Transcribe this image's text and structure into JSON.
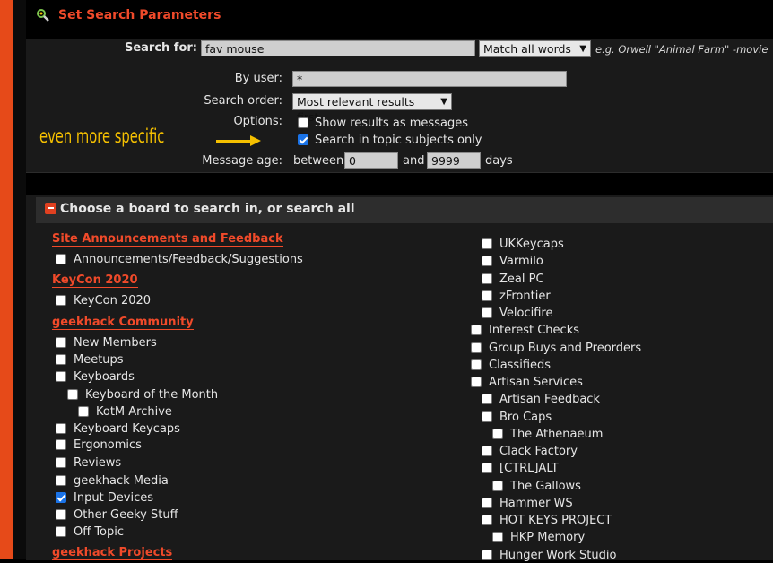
{
  "page": {
    "title": "Set Search Parameters"
  },
  "search": {
    "search_for_label": "Search for:",
    "query": "fav mouse",
    "match_mode": "Match all words",
    "example": "e.g. Orwell \"Animal Farm\" -movie",
    "by_user_label": "By user:",
    "by_user_value": "*",
    "order_label": "Search order:",
    "order_value": "Most relevant results first",
    "options_label": "Options:",
    "option_messages": "Show results as messages",
    "option_subjects": "Search in topic subjects only",
    "age_label": "Message age:",
    "age_between": "between",
    "age_min": "0",
    "age_and": "and",
    "age_max": "9999",
    "age_days": "days"
  },
  "annotation": {
    "text": "even more specific"
  },
  "boards_section": {
    "title": "Choose a board to search in, or search all"
  },
  "left_column": [
    {
      "type": "cat",
      "label": "Site Announcements and Feedback"
    },
    {
      "type": "board",
      "label": "Announcements/Feedback/Suggestions",
      "checked": false,
      "level": 0
    },
    {
      "type": "cat",
      "label": "KeyCon 2020"
    },
    {
      "type": "board",
      "label": "KeyCon 2020",
      "checked": false,
      "level": 0
    },
    {
      "type": "cat",
      "label": "geekhack Community"
    },
    {
      "type": "board",
      "label": "New Members",
      "checked": false,
      "level": 0
    },
    {
      "type": "board",
      "label": "Meetups",
      "checked": false,
      "level": 0
    },
    {
      "type": "board",
      "label": "Keyboards",
      "checked": false,
      "level": 0
    },
    {
      "type": "board",
      "label": "Keyboard of the Month",
      "checked": false,
      "level": 1
    },
    {
      "type": "board",
      "label": "KotM Archive",
      "checked": false,
      "level": 2
    },
    {
      "type": "board",
      "label": "Keyboard Keycaps",
      "checked": false,
      "level": 0
    },
    {
      "type": "board",
      "label": "Ergonomics",
      "checked": false,
      "level": 0
    },
    {
      "type": "board",
      "label": "Reviews",
      "checked": false,
      "level": 0
    },
    {
      "type": "board",
      "label": "geekhack Media",
      "checked": false,
      "level": 0
    },
    {
      "type": "board",
      "label": "Input Devices",
      "checked": true,
      "level": 0
    },
    {
      "type": "board",
      "label": "Other Geeky Stuff",
      "checked": false,
      "level": 0
    },
    {
      "type": "board",
      "label": "Off Topic",
      "checked": false,
      "level": 0
    },
    {
      "type": "cat",
      "label": "geekhack Projects"
    }
  ],
  "right_column": [
    {
      "label": "UKKeycaps",
      "checked": false,
      "level": 1
    },
    {
      "label": "Varmilo",
      "checked": false,
      "level": 1
    },
    {
      "label": "Zeal PC",
      "checked": false,
      "level": 1
    },
    {
      "label": "zFrontier",
      "checked": false,
      "level": 1
    },
    {
      "label": "Velocifire",
      "checked": false,
      "level": 1
    },
    {
      "label": "Interest Checks",
      "checked": false,
      "level": 0
    },
    {
      "label": "Group Buys and Preorders",
      "checked": false,
      "level": 0
    },
    {
      "label": "Classifieds",
      "checked": false,
      "level": 0
    },
    {
      "label": "Artisan Services",
      "checked": false,
      "level": 0
    },
    {
      "label": "Artisan Feedback",
      "checked": false,
      "level": 1
    },
    {
      "label": "Bro Caps",
      "checked": false,
      "level": 1
    },
    {
      "label": "The Athenaeum",
      "checked": false,
      "level": 2
    },
    {
      "label": "Clack Factory",
      "checked": false,
      "level": 1
    },
    {
      "label": "[CTRL]ALT",
      "checked": false,
      "level": 1
    },
    {
      "label": "The Gallows",
      "checked": false,
      "level": 2
    },
    {
      "label": "Hammer WS",
      "checked": false,
      "level": 1
    },
    {
      "label": "HOT KEYS PROJECT",
      "checked": false,
      "level": 1
    },
    {
      "label": "HKP Memory",
      "checked": false,
      "level": 2
    },
    {
      "label": "Hunger Work Studio",
      "checked": false,
      "level": 1
    }
  ],
  "colors": {
    "accent": "#f04a2a",
    "annotation": "#f5c000",
    "checkbox_checked": "#1a73e8"
  }
}
